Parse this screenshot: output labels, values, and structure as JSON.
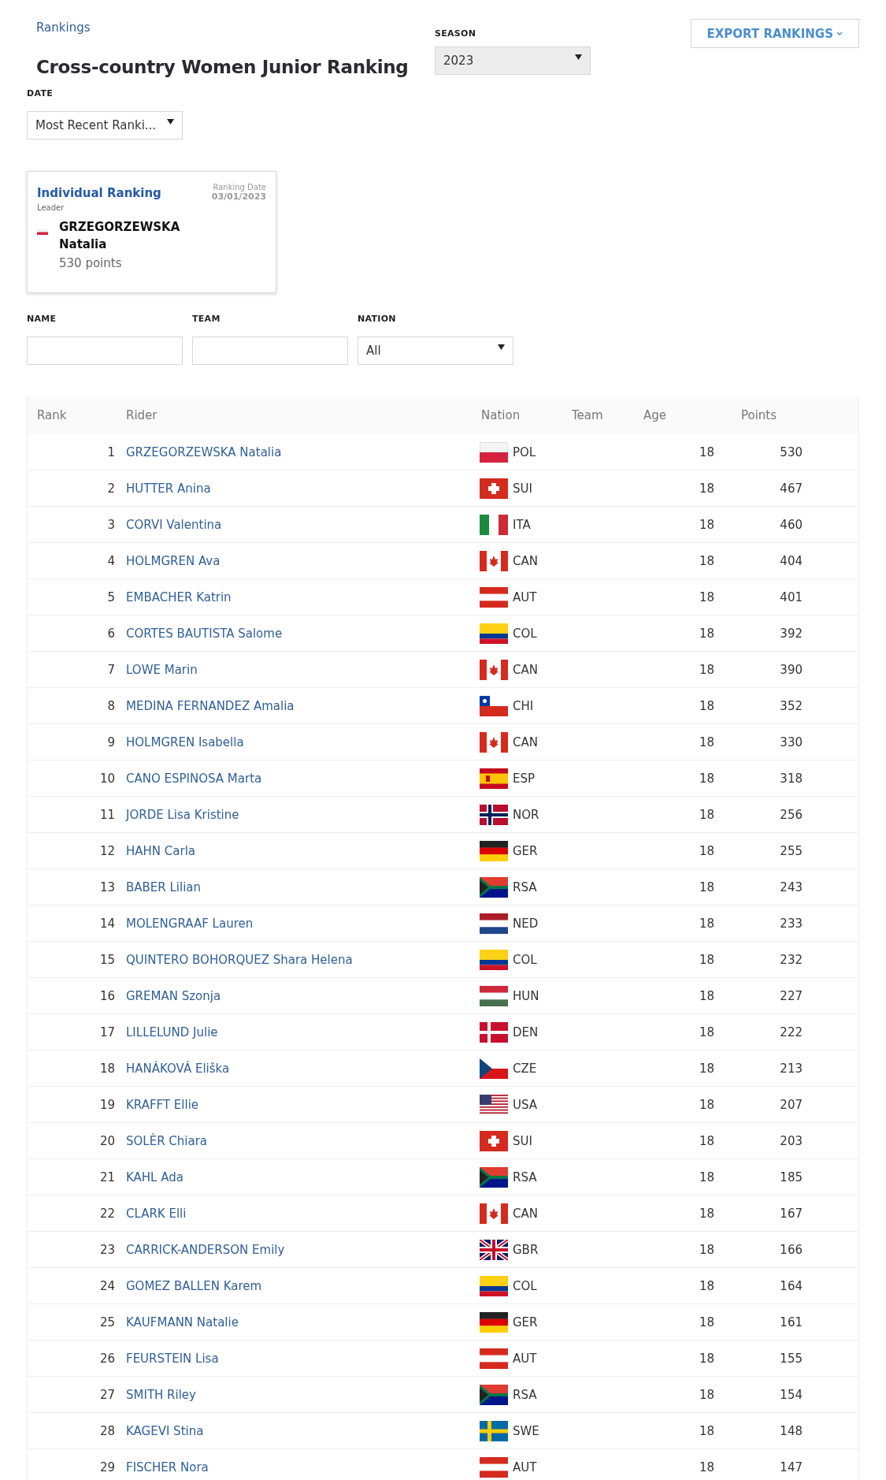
{
  "breadcrumb": "Rankings",
  "title": "Cross-country Women Junior Ranking",
  "season": {
    "label": "SEASON",
    "value": "2023"
  },
  "export_button": "EXPORT RANKINGS",
  "date": {
    "label": "DATE",
    "value": "Most Recent Ranki..."
  },
  "leader_card": {
    "title": "Individual Ranking",
    "date_label": "Ranking Date",
    "date": "03/01/2023",
    "leader_label": "Leader",
    "flag": {
      "kind": "pol"
    },
    "surname": "GRZEGORZEWSKA",
    "first_name": "Natalia",
    "points": "530 points"
  },
  "filters": [
    {
      "label": "NAME",
      "kind": "text"
    },
    {
      "label": "TEAM",
      "kind": "text"
    },
    {
      "label": "NATION",
      "kind": "select",
      "value": "All"
    }
  ],
  "table": {
    "columns": [
      "Rank",
      "Rider",
      "Nation",
      "Team",
      "Age",
      "Points"
    ],
    "rows": [
      {
        "rank": "1",
        "rider": "GRZEGORZEWSKA Natalia",
        "kind": "pol",
        "nation": "POL",
        "age": "18",
        "points": "530"
      },
      {
        "rank": "2",
        "rider": "HUTTER Anina",
        "kind": "sui",
        "nation": "SUI",
        "age": "18",
        "points": "467"
      },
      {
        "rank": "3",
        "rider": "CORVI Valentina",
        "kind": "ita",
        "nation": "ITA",
        "age": "18",
        "points": "460"
      },
      {
        "rank": "4",
        "rider": "HOLMGREN Ava",
        "kind": "can",
        "nation": "CAN",
        "age": "18",
        "points": "404"
      },
      {
        "rank": "5",
        "rider": "EMBACHER Katrin",
        "kind": "aut",
        "nation": "AUT",
        "age": "18",
        "points": "401"
      },
      {
        "rank": "6",
        "rider": "CORTES BAUTISTA Salome",
        "kind": "col",
        "nation": "COL",
        "age": "18",
        "points": "392"
      },
      {
        "rank": "7",
        "rider": "LOWE Marin",
        "kind": "can",
        "nation": "CAN",
        "age": "18",
        "points": "390"
      },
      {
        "rank": "8",
        "rider": "MEDINA FERNANDEZ Amalia",
        "kind": "chi",
        "nation": "CHI",
        "age": "18",
        "points": "352"
      },
      {
        "rank": "9",
        "rider": "HOLMGREN Isabella",
        "kind": "can",
        "nation": "CAN",
        "age": "18",
        "points": "330"
      },
      {
        "rank": "10",
        "rider": "CANO ESPINOSA Marta",
        "kind": "esp",
        "nation": "ESP",
        "age": "18",
        "points": "318"
      },
      {
        "rank": "11",
        "rider": "JORDE Lisa Kristine",
        "kind": "nor",
        "nation": "NOR",
        "age": "18",
        "points": "256"
      },
      {
        "rank": "12",
        "rider": "HAHN Carla",
        "kind": "ger",
        "nation": "GER",
        "age": "18",
        "points": "255"
      },
      {
        "rank": "13",
        "rider": "BABER Lilian",
        "kind": "rsa",
        "nation": "RSA",
        "age": "18",
        "points": "243"
      },
      {
        "rank": "14",
        "rider": "MOLENGRAAF Lauren",
        "kind": "ned",
        "nation": "NED",
        "age": "18",
        "points": "233"
      },
      {
        "rank": "15",
        "rider": "QUINTERO BOHORQUEZ Shara Helena",
        "kind": "col",
        "nation": "COL",
        "age": "18",
        "points": "232"
      },
      {
        "rank": "16",
        "rider": "GREMAN Szonja",
        "kind": "hun",
        "nation": "HUN",
        "age": "18",
        "points": "227"
      },
      {
        "rank": "17",
        "rider": "LILLELUND Julie",
        "kind": "den",
        "nation": "DEN",
        "age": "18",
        "points": "222"
      },
      {
        "rank": "18",
        "rider": "HANÁKOVÁ Eliška",
        "kind": "cze",
        "nation": "CZE",
        "age": "18",
        "points": "213"
      },
      {
        "rank": "19",
        "rider": "KRAFFT Ellie",
        "kind": "usa",
        "nation": "USA",
        "age": "18",
        "points": "207"
      },
      {
        "rank": "20",
        "rider": "SOLÈR Chiara",
        "kind": "sui",
        "nation": "SUI",
        "age": "18",
        "points": "203"
      },
      {
        "rank": "21",
        "rider": "KAHL Ada",
        "kind": "rsa",
        "nation": "RSA",
        "age": "18",
        "points": "185"
      },
      {
        "rank": "22",
        "rider": "CLARK Elli",
        "kind": "can",
        "nation": "CAN",
        "age": "18",
        "points": "167"
      },
      {
        "rank": "23",
        "rider": "CARRICK-ANDERSON Emily",
        "kind": "gbr",
        "nation": "GBR",
        "age": "18",
        "points": "166"
      },
      {
        "rank": "24",
        "rider": "GOMEZ BALLEN Karem",
        "kind": "col",
        "nation": "COL",
        "age": "18",
        "points": "164"
      },
      {
        "rank": "25",
        "rider": "KAUFMANN Natalie",
        "kind": "ger",
        "nation": "GER",
        "age": "18",
        "points": "161"
      },
      {
        "rank": "26",
        "rider": "FEURSTEIN Lisa",
        "kind": "aut",
        "nation": "AUT",
        "age": "18",
        "points": "155"
      },
      {
        "rank": "27",
        "rider": "SMITH Riley",
        "kind": "rsa",
        "nation": "RSA",
        "age": "18",
        "points": "154"
      },
      {
        "rank": "28",
        "rider": "KAGEVI Stina",
        "kind": "swe",
        "nation": "SWE",
        "age": "18",
        "points": "148"
      },
      {
        "rank": "29",
        "rider": "FISCHER Nora",
        "kind": "aut",
        "nation": "AUT",
        "age": "18",
        "points": "147"
      }
    ]
  }
}
